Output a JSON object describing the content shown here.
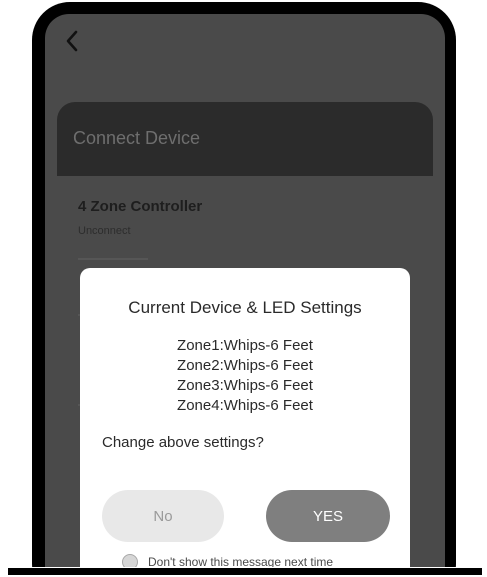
{
  "nav": {
    "back_icon": "chevron-left-icon"
  },
  "header": {
    "title": "Connect Device"
  },
  "device": {
    "name": "4 Zone Controller",
    "status": "Unconnect"
  },
  "dialog": {
    "title": "Current Device & LED Settings",
    "zones": [
      "Zone1:Whips-6 Feet",
      "Zone2:Whips-6 Feet",
      "Zone3:Whips-6 Feet",
      "Zone4:Whips-6 Feet"
    ],
    "question": "Change above settings?",
    "no_label": "No",
    "yes_label": "YES",
    "dont_show_label": "Don't show this message next time"
  },
  "colors": {
    "overlay": "#4a4a4a",
    "header_card": "#2b2b2b",
    "yes_button": "#7f7f7f",
    "no_button": "#e8e8e8"
  }
}
